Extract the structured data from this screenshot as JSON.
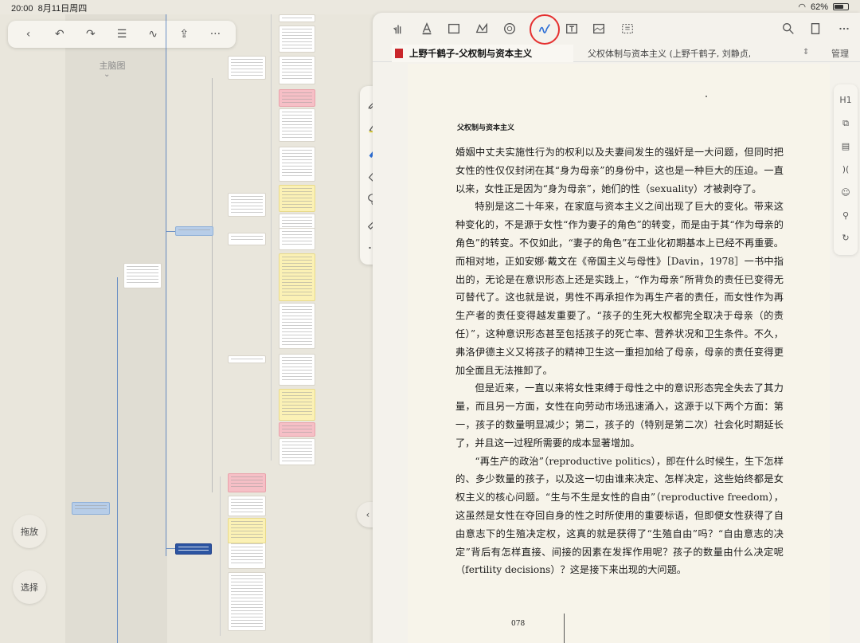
{
  "status": {
    "time": "20:00",
    "date": "8月11日周四",
    "battery": "62%"
  },
  "left": {
    "mind_title": "主脑图",
    "drag_button": "拖放",
    "select_button": "选择",
    "toolbar_icons": [
      "back-icon",
      "undo-icon",
      "redo-icon",
      "list-icon",
      "scribble-icon",
      "share-icon",
      "more-icon"
    ]
  },
  "pdf": {
    "tabs": [
      {
        "label": "上野千鹤子-父权制与资本主义",
        "active": true
      },
      {
        "label": "父权体制与资本主义 (上野千鹤子, 刘静贞,…",
        "active": false
      }
    ],
    "manage_label": "管理",
    "page_header": "父权制与资本主义",
    "page_number": "078",
    "paragraphs": [
      {
        "indent": false,
        "text": "婚姻中丈夫实施性行为的权利以及夫妻间发生的强奸是一大问题，但同时把女性的性仅仅封闭在其“身为母亲”的身份中，这也是一种巨大的压迫。一直以来，女性正是因为“身为母亲”，她们的性（sexuality）才被剥夺了。"
      },
      {
        "indent": true,
        "text": "特别是这二十年来，在家庭与资本主义之间出现了巨大的变化。带来这种变化的，不是源于女性“作为妻子的角色”的转变，而是由于其“作为母亲的角色”的转变。不仅如此，“妻子的角色”在工业化初期基本上已经不再重要。而相对地，正如安娜·戴文在《帝国主义与母性》［Davin，1978］一书中指出的，无论是在意识形态上还是实践上，“作为母亲”所背负的责任已变得无可替代了。这也就是说，男性不再承担作为再生产者的责任，而女性作为再生产者的责任变得越发重要了。“孩子的生死大权都完全取决于母亲（的责任）”，这种意识形态甚至包括孩子的死亡率、营养状况和卫生条件。不久，弗洛伊德主义又将孩子的精神卫生这一重担加给了母亲，母亲的责任变得更加全面且无法推卸了。"
      },
      {
        "indent": true,
        "text": "但是近来，一直以来将女性束缚于母性之中的意识形态完全失去了其力量，而且另一方面，女性在向劳动市场迅速涌入，这源于以下两个方面：第一，孩子的数量明显减少；第二，孩子的（特别是第二次）社会化时期延长了，并且这一过程所需要的成本显著增加。"
      },
      {
        "indent": true,
        "text": "“再生产的政治”（reproductive politics），即在什么时候生，生下怎样的、多少数量的孩子，以及这一切由谁来决定、怎样决定，这些始终都是女权主义的核心问题。“生与不生是女性的自由”（reproductive freedom），这虽然是女性在夺回自身的性之时所使用的重要标语，但即便女性获得了自由意志下的生殖决定权，这真的就是获得了“生殖自由”吗？“自由意志的决定”背后有怎样直接、间接的因素在发挥作用呢？孩子的数量由什么决定呢（fertility decisions）？这是接下来出现的大问题。"
      }
    ]
  },
  "colors": {
    "accent_ring": "#e53030",
    "mind_line": "#6b8fc4",
    "pink_node": "#f6bfc6",
    "yellow_node": "#fbf1b5",
    "blue_node": "#b7cde8"
  }
}
